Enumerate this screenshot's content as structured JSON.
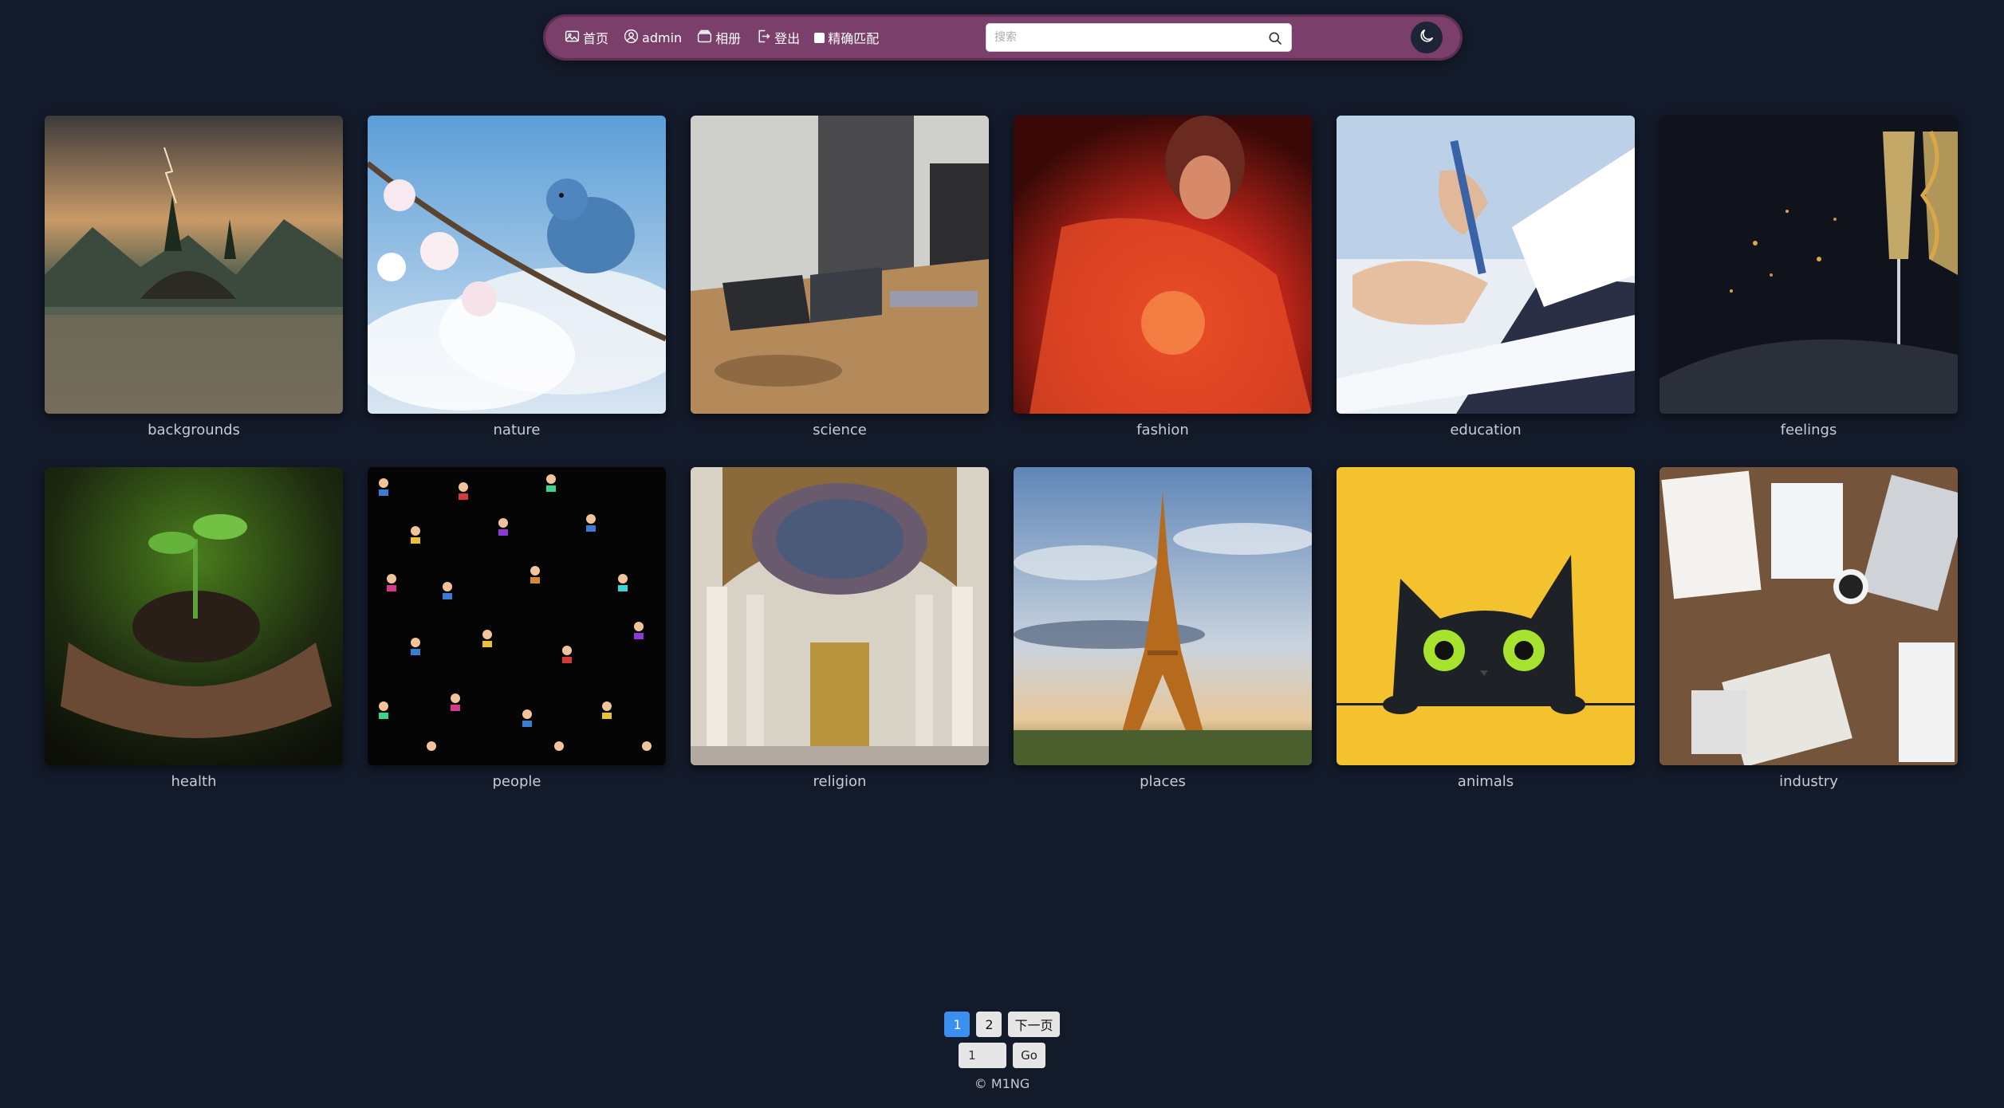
{
  "nav": {
    "home_label": "首页",
    "user_label": "admin",
    "album_label": "相册",
    "logout_label": "登出",
    "exact_match_label": "精确匹配",
    "search_placeholder": "搜索"
  },
  "gallery": [
    {
      "label": "backgrounds"
    },
    {
      "label": "nature"
    },
    {
      "label": "science"
    },
    {
      "label": "fashion"
    },
    {
      "label": "education"
    },
    {
      "label": "feelings"
    },
    {
      "label": "health"
    },
    {
      "label": "people"
    },
    {
      "label": "religion"
    },
    {
      "label": "places"
    },
    {
      "label": "animals"
    },
    {
      "label": "industry"
    }
  ],
  "pagination": {
    "pages": [
      "1",
      "2"
    ],
    "current": "1",
    "next_label": "下一页",
    "jump_value": "1",
    "go_label": "Go"
  },
  "footer": {
    "text": "© M1NG"
  },
  "colors": {
    "background": "#131a2a",
    "navbar": "#7a3f6b",
    "active_page": "#3b8ff0"
  }
}
